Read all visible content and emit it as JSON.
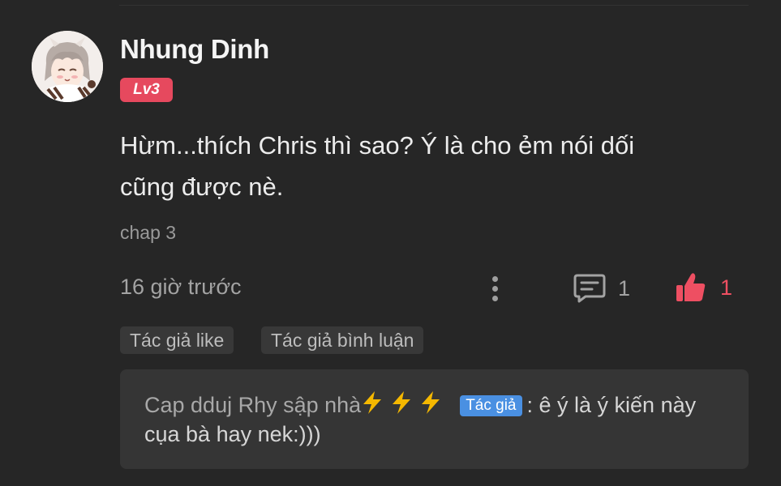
{
  "comment": {
    "username": "Nhung Dinh",
    "level": "Lv3",
    "body": "Hừm...thích Chris thì sao? Ý là cho ẻm nói dối\ncũng được nè.",
    "chapter": "chap 3",
    "timestamp": "16 giờ trước",
    "reply_count": "1",
    "like_count": "1"
  },
  "tags": {
    "author_like": "Tác giả like",
    "author_comment": "Tác giả bình luận"
  },
  "reply": {
    "author": "Cap dduj Rhy sập nhà",
    "author_badge": "Tác giả",
    "text": ": ê ý là ý kiến này cụa bà hay nek:)))"
  },
  "colors": {
    "background": "#262626",
    "accent_red": "#e6495e",
    "author_badge_blue": "#4a90e2",
    "reply_box": "#353535",
    "bolt_yellow": "#f5b800"
  },
  "icons": {
    "more": "vertical-dots-icon",
    "reply": "comment-bubble-icon",
    "like": "thumbs-up-icon",
    "bolt": "lightning-bolt-icon"
  }
}
